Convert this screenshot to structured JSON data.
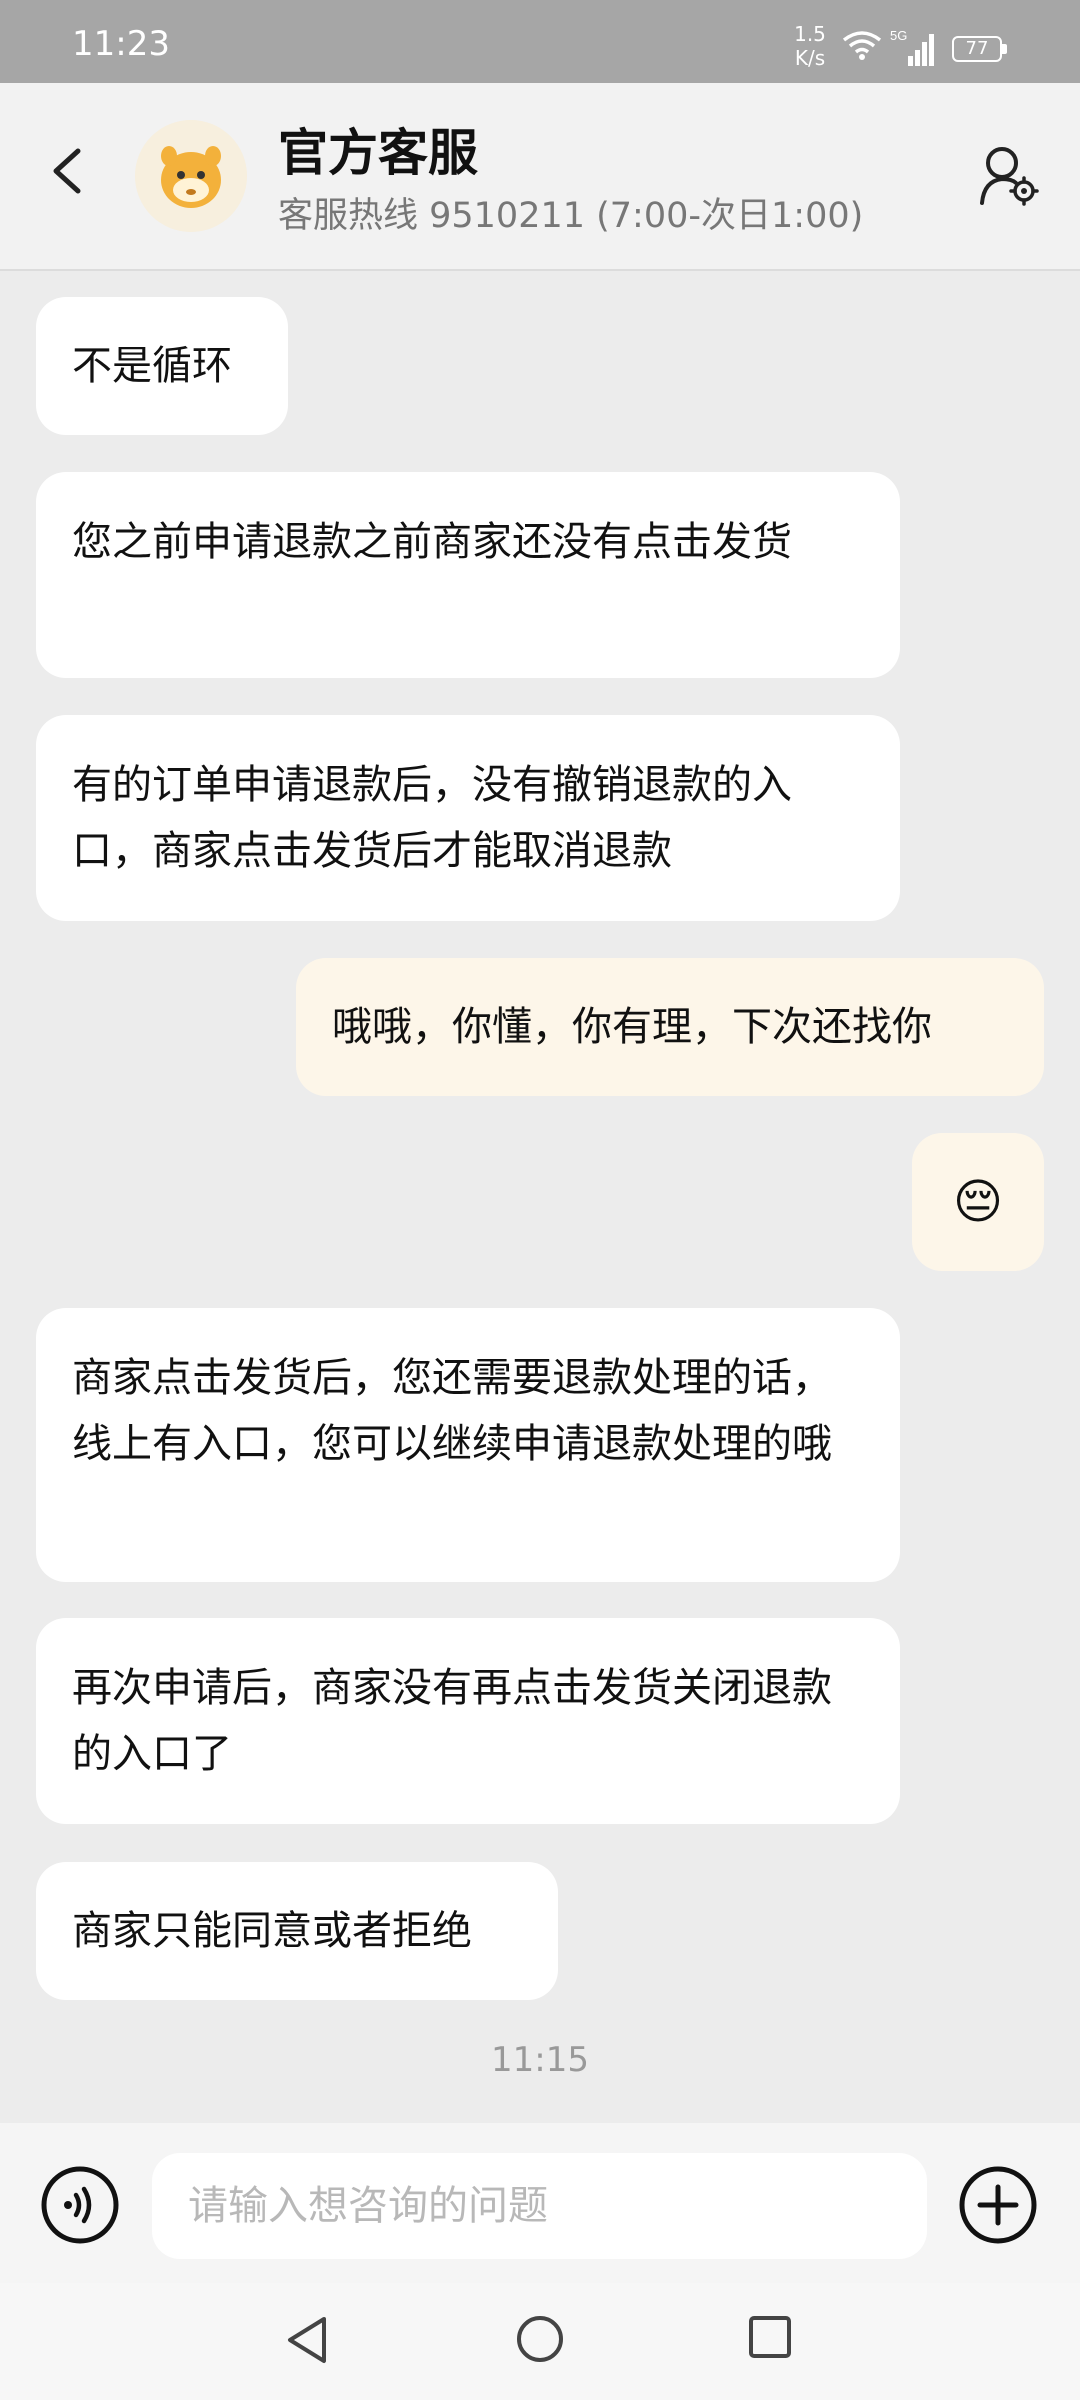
{
  "status_bar": {
    "time": "11:23",
    "net_speed_value": "1.5",
    "net_speed_unit": "K/s",
    "network": "5G",
    "battery": "77"
  },
  "header": {
    "title": "官方客服",
    "subtitle": "客服热线 9510211 (7:00-次日1:00)"
  },
  "messages": [
    {
      "side": "left",
      "text": "不是循环"
    },
    {
      "side": "left",
      "text": "您之前申请退款之前商家还没有点击发货"
    },
    {
      "side": "left",
      "text": "有的订单申请退款后，没有撤销退款的入口，商家点击发货后才能取消退款"
    },
    {
      "side": "right",
      "text": "哦哦，你懂，你有理，下次还找你"
    },
    {
      "side": "right",
      "text": "😔",
      "type": "emoji"
    },
    {
      "side": "left",
      "text": "商家点击发货后，您还需要退款处理的话，线上有入口，您可以继续申请退款处理的哦"
    },
    {
      "side": "left",
      "text": "再次申请后，商家没有再点击发货关闭退款的入口了"
    },
    {
      "side": "left",
      "text": "商家只能同意或者拒绝"
    }
  ],
  "timestamp": "11:15",
  "input": {
    "placeholder": "请输入想咨询的问题",
    "value": ""
  },
  "icons": {
    "back": "chevron-left-icon",
    "profile_settings": "user-gear-icon",
    "voice": "voice-wave-icon",
    "add": "plus-circle-icon"
  },
  "colors": {
    "user_bubble": "#fdf6e9",
    "agent_bubble": "#ffffff",
    "chat_background": "#ececec",
    "status_bar": "#a6a6a6"
  }
}
